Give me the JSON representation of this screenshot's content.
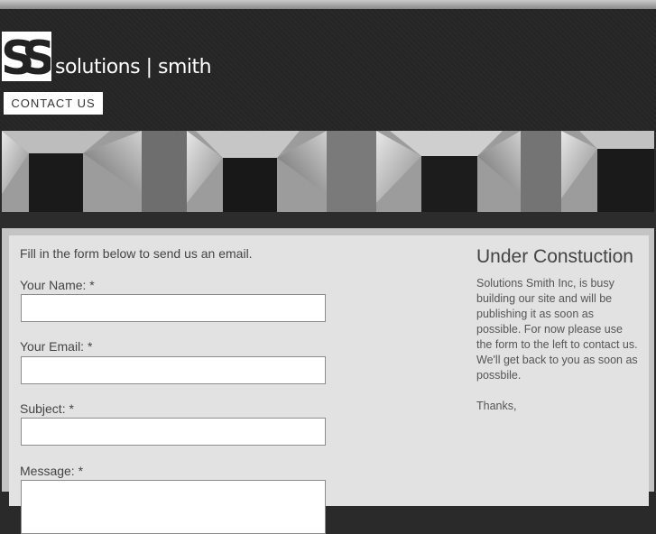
{
  "brand": {
    "mark_text": "SS",
    "name": "solutions | smith"
  },
  "nav": {
    "contact_label": "CONTACT US"
  },
  "form": {
    "intro": "Fill in the form below to send us an email.",
    "fields": [
      {
        "label": "Your Name: *",
        "value": "",
        "placeholder": ""
      },
      {
        "label": "Your Email: *",
        "value": "",
        "placeholder": ""
      },
      {
        "label": "Subject: *",
        "value": "",
        "placeholder": ""
      },
      {
        "label": "Message: *",
        "value": "",
        "placeholder": ""
      }
    ]
  },
  "sidebar": {
    "title": "Under Constuction",
    "body": "Solutions Smith Inc, is busy building our site and will be publishing it as soon as possible. For now please use the form to the left to contact us. We'll get back to you as soon as possbile.",
    "thanks": "Thanks,"
  },
  "colors": {
    "header_bg": "#262626",
    "content_bg": "#e2e2e2",
    "frame_bg": "#c4c4c4",
    "text": "#444444"
  }
}
